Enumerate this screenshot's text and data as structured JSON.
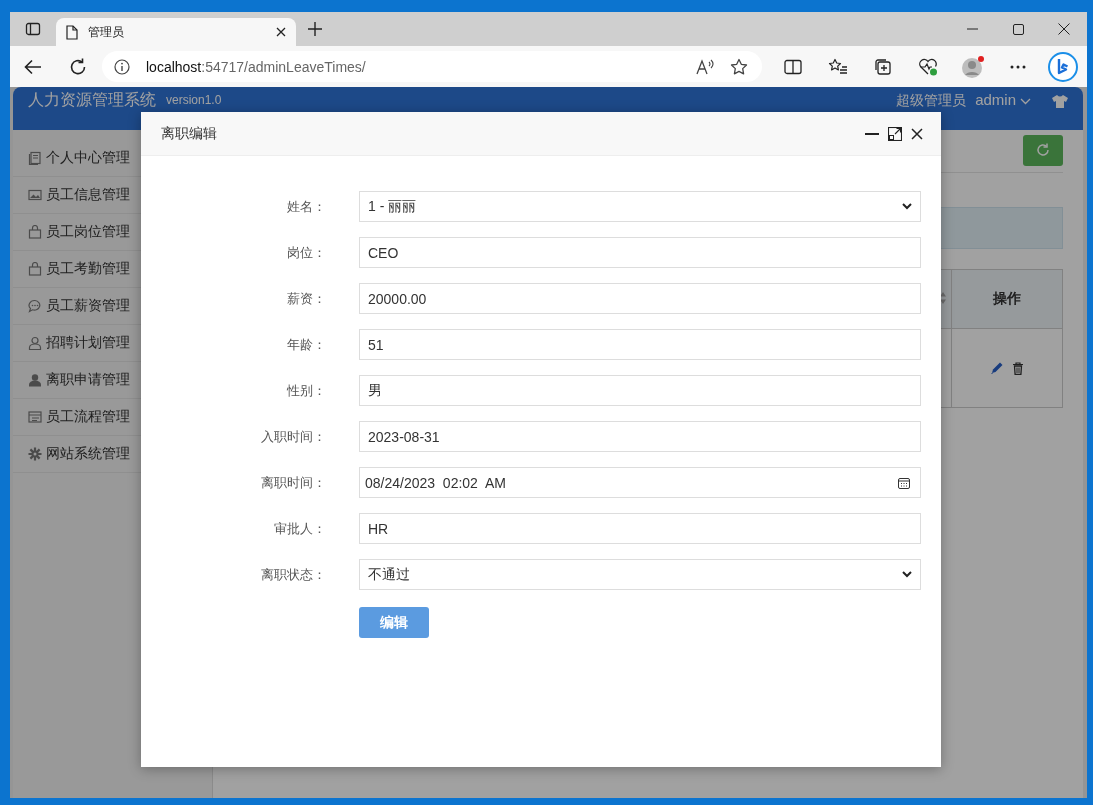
{
  "browser": {
    "tab_title": "管理员",
    "url_host": "localhost",
    "url_path": ":54717/adminLeaveTimes/"
  },
  "app": {
    "title": "人力资源管理系统",
    "version": "version1.0",
    "user_role": "超级管理员",
    "username": "admin"
  },
  "sidebar": {
    "items": [
      {
        "label": "个人中心管理"
      },
      {
        "label": "员工信息管理"
      },
      {
        "label": "员工岗位管理"
      },
      {
        "label": "员工考勤管理"
      },
      {
        "label": "员工薪资管理"
      },
      {
        "label": "招聘计划管理"
      },
      {
        "label": "离职申请管理"
      },
      {
        "label": "员工流程管理"
      },
      {
        "label": "网站系统管理"
      }
    ]
  },
  "table": {
    "columns": [
      {
        "label": "操作"
      }
    ],
    "rows": [
      {
        "actions": [
          {
            "kind": "edit"
          },
          {
            "kind": "delete"
          }
        ]
      }
    ]
  },
  "dialog": {
    "title": "离职编辑",
    "fields": [
      {
        "label": "姓名：",
        "kind": "select",
        "value": "1 - 丽丽"
      },
      {
        "label": "岗位：",
        "kind": "text",
        "value": "CEO"
      },
      {
        "label": "薪资：",
        "kind": "text",
        "value": "20000.00"
      },
      {
        "label": "年龄：",
        "kind": "text",
        "value": "51"
      },
      {
        "label": "性别：",
        "kind": "text",
        "value": "男"
      },
      {
        "label": "入职时间：",
        "kind": "text",
        "value": "2023-08-31"
      },
      {
        "label": "离职时间：",
        "kind": "datetime",
        "value": "08/24/2023  02:02  AM"
      },
      {
        "label": "审批人：",
        "kind": "text",
        "value": "HR"
      },
      {
        "label": "离职状态：",
        "kind": "select",
        "value": "不通过"
      }
    ],
    "submit": "编辑"
  }
}
